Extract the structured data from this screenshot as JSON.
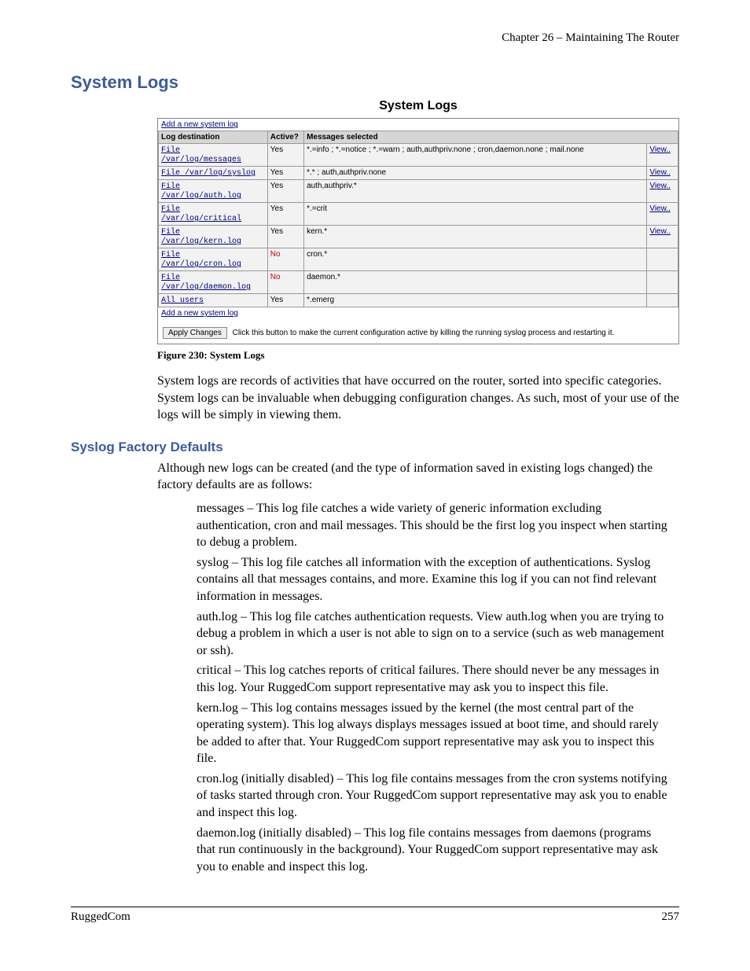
{
  "chapter": "Chapter 26 – Maintaining The Router",
  "section_title": "System Logs",
  "panel": {
    "title": "System Logs",
    "add_link": "Add a new system log",
    "columns": {
      "dest": "Log destination",
      "active": "Active?",
      "msg": "Messages selected"
    },
    "rows": [
      {
        "dest": "File /var/log/messages",
        "active": "Yes",
        "active_no": false,
        "msg": "*.=info ; *.=notice ; *.=warn ; auth,authpriv.none ; cron,daemon.none ; mail.none",
        "view": "View.."
      },
      {
        "dest": "File /var/log/syslog",
        "active": "Yes",
        "active_no": false,
        "msg": "*.* ; auth,authpriv.none",
        "view": "View.."
      },
      {
        "dest": "File /var/log/auth.log",
        "active": "Yes",
        "active_no": false,
        "msg": "auth,authpriv.*",
        "view": "View.."
      },
      {
        "dest": "File /var/log/critical",
        "active": "Yes",
        "active_no": false,
        "msg": "*.=crit",
        "view": "View.."
      },
      {
        "dest": "File /var/log/kern.log",
        "active": "Yes",
        "active_no": false,
        "msg": "kern.*",
        "view": "View.."
      },
      {
        "dest": "File /var/log/cron.log",
        "active": "No",
        "active_no": true,
        "msg": "cron.*",
        "view": ""
      },
      {
        "dest": "File /var/log/daemon.log",
        "active": "No",
        "active_no": true,
        "msg": "daemon.*",
        "view": ""
      },
      {
        "dest": "All users",
        "active": "Yes",
        "active_no": false,
        "msg": "*.emerg",
        "view": ""
      }
    ],
    "apply_label": "Apply Changes",
    "apply_desc": "Click this button to make the current configuration active by killing the running syslog process and restarting it."
  },
  "figure_caption": "Figure 230: System Logs",
  "intro_para": "System logs are records of activities that have occurred on the router, sorted into specific categories.  System logs can be invaluable when debugging configuration changes.  As such, most of your use of the logs will be simply in viewing them.",
  "subsection_title": "Syslog Factory Defaults",
  "subsection_intro": "Although new logs can be created (and the type of information saved in existing logs changed) the factory defaults are as follows:",
  "defs": {
    "messages": "messages – This log file catches a wide variety of generic information excluding authentication, cron and mail messages.  This should be the first log you inspect when starting to debug a problem.",
    "syslog": "syslog – This log file catches all information with the exception of authentications.  Syslog contains all that messages contains, and more.  Examine this log if you can not find relevant information in messages.",
    "authlog": "auth.log – This log file catches authentication requests.  View auth.log when you are trying to debug a problem in which a user is not able to sign on to a service (such as web management or ssh).",
    "critical": "critical – This log catches reports of critical failures.  There should never be any messages in this log.  Your RuggedCom support representative may ask you to inspect this file.",
    "kernlog": "kern.log – This log contains messages issued by the kernel (the most central part of the operating system).  This log always displays messages issued at boot time, and should rarely be added to after that.  Your RuggedCom support representative may ask you to inspect this file.",
    "cronlog": "cron.log (initially disabled) – This log file contains messages from the cron systems notifying of tasks started through cron.  Your RuggedCom support representative may ask you to enable and inspect this log.",
    "daemonlog": "daemon.log (initially disabled) – This log file contains messages from daemons (programs that run continuously in the background).   Your RuggedCom support representative may ask you to enable and inspect this log."
  },
  "footer": {
    "left": "RuggedCom",
    "right": "257"
  }
}
